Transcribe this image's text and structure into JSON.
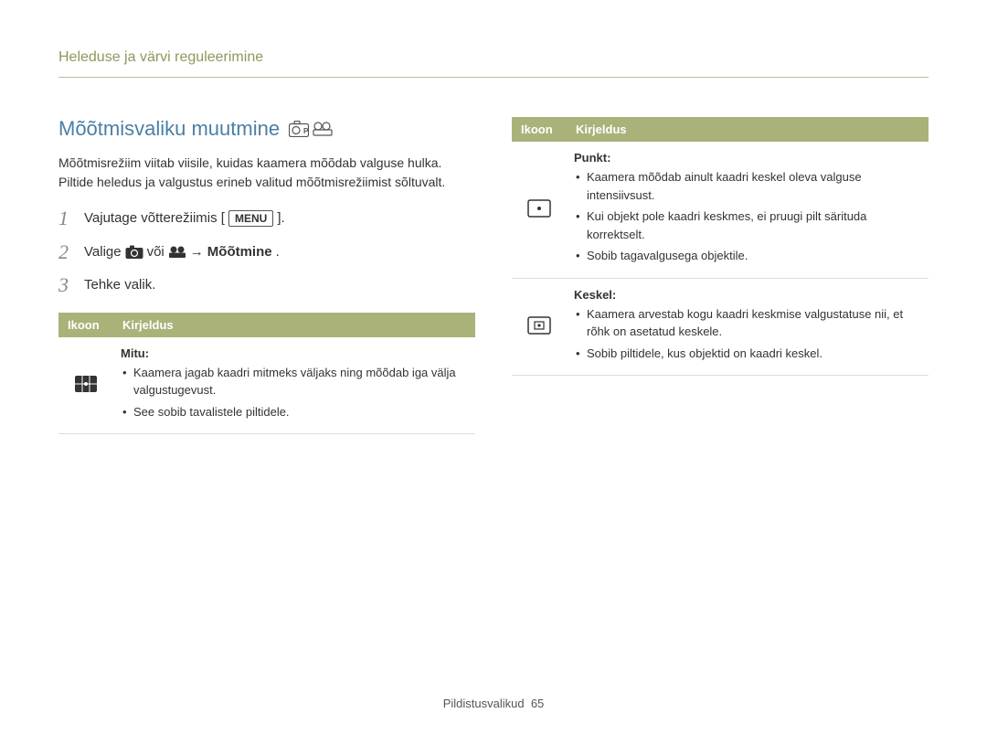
{
  "header": {
    "title": "Heleduse ja värvi reguleerimine"
  },
  "section": {
    "title": "Mõõtmisvaliku muutmine",
    "intro": "Mõõtmisrežiim viitab viisile, kuidas kaamera mõõdab valguse hulka. Piltide heledus ja valgustus erineb valitud mõõtmisrežiimist sõltuvalt."
  },
  "steps": {
    "s1": {
      "num": "1",
      "pre": "Vajutage võtterežiimis [",
      "btn": "MENU",
      "post": "]."
    },
    "s2": {
      "num": "2",
      "pre": "Valige",
      "mid": " või ",
      "arrow": "→",
      "target": "Mõõtmine",
      "end": "."
    },
    "s3": {
      "num": "3",
      "text": "Tehke valik."
    }
  },
  "table": {
    "th_icon": "Ikoon",
    "th_desc": "Kirjeldus"
  },
  "rows_left": {
    "mitu": {
      "title": "Mitu:",
      "li1": "Kaamera jagab kaadri mitmeks väljaks ning mõõdab iga välja valgustugevust.",
      "li2": "See sobib tavalistele piltidele."
    }
  },
  "rows_right": {
    "punkt": {
      "title": "Punkt:",
      "li1": "Kaamera mõõdab ainult kaadri keskel oleva valguse intensiivsust.",
      "li2": "Kui objekt pole kaadri keskmes, ei pruugi pilt särituda korrektselt.",
      "li3": "Sobib tagavalgusega objektile."
    },
    "keskel": {
      "title": "Keskel:",
      "li1": "Kaamera arvestab kogu kaadri keskmise valgustatuse nii, et rõhk on asetatud keskele.",
      "li2": "Sobib piltidele, kus objektid on kaadri keskel."
    }
  },
  "footer": {
    "section": "Pildistusvalikud",
    "page": "65"
  }
}
